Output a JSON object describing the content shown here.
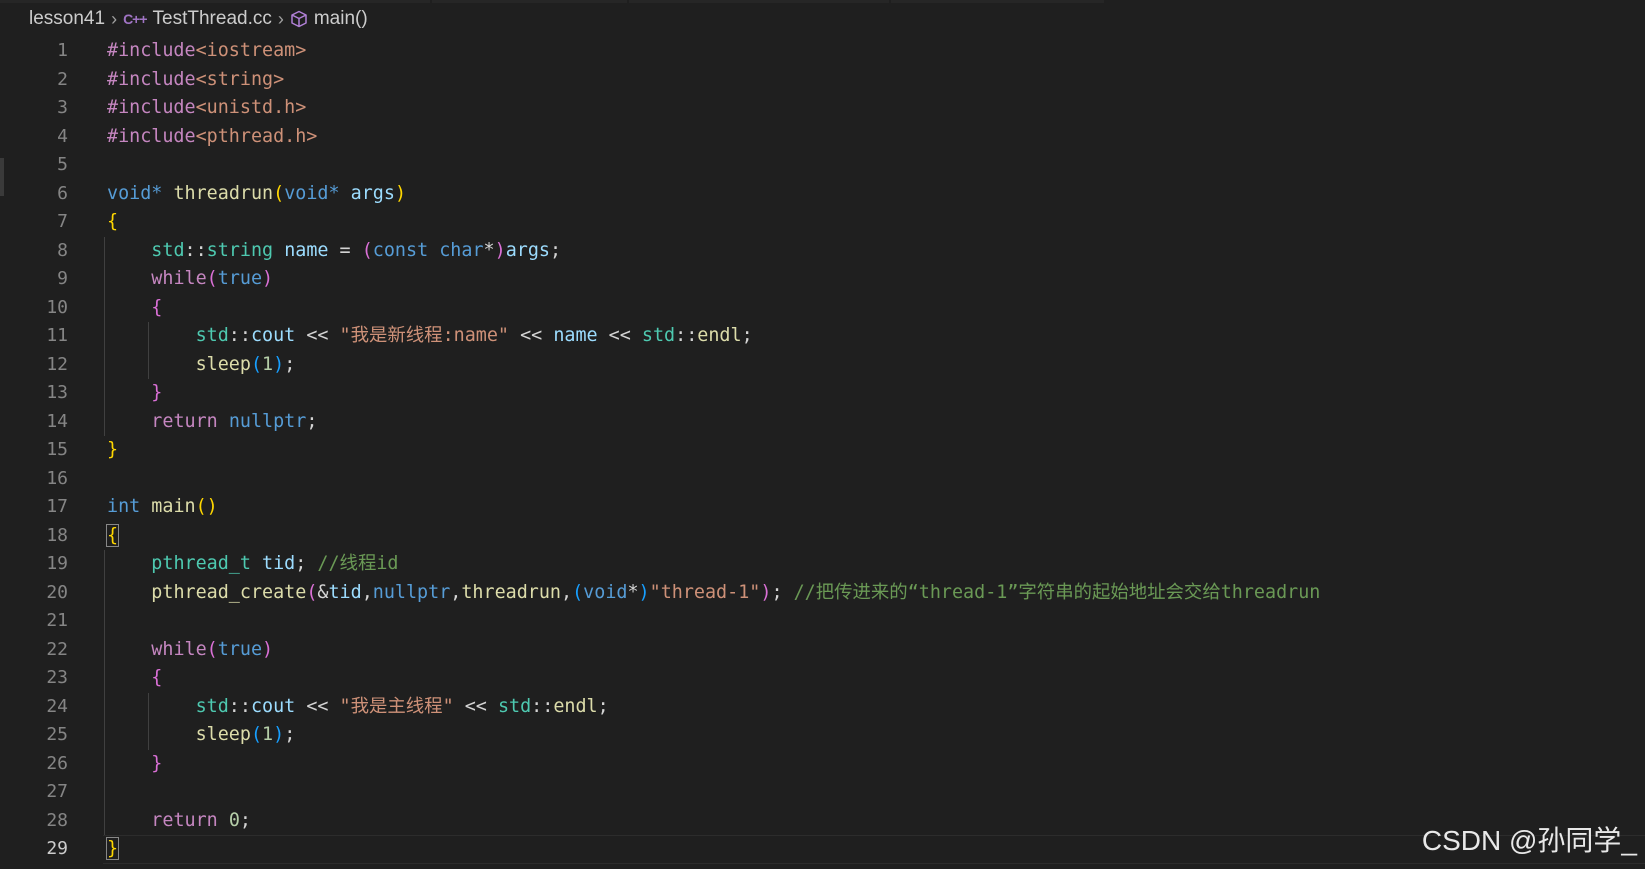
{
  "breadcrumb": {
    "folder": "lesson41",
    "file_icon": "C++",
    "file": "TestThread.cc",
    "symbol_icon": "cube-icon",
    "symbol": "main()"
  },
  "editor": {
    "current_line": 29,
    "lines": [
      {
        "n": "1",
        "tokens": [
          [
            "pp",
            "#include"
          ],
          [
            "str",
            "<iostream>"
          ]
        ]
      },
      {
        "n": "2",
        "tokens": [
          [
            "pp",
            "#include"
          ],
          [
            "str",
            "<string>"
          ]
        ]
      },
      {
        "n": "3",
        "tokens": [
          [
            "pp",
            "#include"
          ],
          [
            "str",
            "<unistd.h>"
          ]
        ]
      },
      {
        "n": "4",
        "tokens": [
          [
            "pp",
            "#include"
          ],
          [
            "str",
            "<pthread.h>"
          ]
        ]
      },
      {
        "n": "5",
        "tokens": []
      },
      {
        "n": "6",
        "tokens": [
          [
            "kw",
            "void"
          ],
          [
            "kw",
            "*"
          ],
          [
            "pl",
            " "
          ],
          [
            "fn",
            "threadrun"
          ],
          [
            "b1",
            "("
          ],
          [
            "kw",
            "void"
          ],
          [
            "kw",
            "*"
          ],
          [
            "pl",
            " "
          ],
          [
            "var",
            "args"
          ],
          [
            "b1",
            ")"
          ]
        ]
      },
      {
        "n": "7",
        "tokens": [
          [
            "b1",
            "{"
          ]
        ]
      },
      {
        "n": "8",
        "tokens": [
          [
            "pl",
            "    "
          ],
          [
            "type",
            "std"
          ],
          [
            "pl",
            "::"
          ],
          [
            "type",
            "string"
          ],
          [
            "pl",
            " "
          ],
          [
            "var",
            "name"
          ],
          [
            "pl",
            " = "
          ],
          [
            "b2",
            "("
          ],
          [
            "kw",
            "const"
          ],
          [
            "pl",
            " "
          ],
          [
            "kw",
            "char"
          ],
          [
            "pl",
            "*"
          ],
          [
            "b2",
            ")"
          ],
          [
            "var",
            "args"
          ],
          [
            "pl",
            ";"
          ]
        ]
      },
      {
        "n": "9",
        "tokens": [
          [
            "pl",
            "    "
          ],
          [
            "ctl",
            "while"
          ],
          [
            "b2",
            "("
          ],
          [
            "kw",
            "true"
          ],
          [
            "b2",
            ")"
          ]
        ]
      },
      {
        "n": "10",
        "tokens": [
          [
            "pl",
            "    "
          ],
          [
            "b2",
            "{"
          ]
        ]
      },
      {
        "n": "11",
        "tokens": [
          [
            "pl",
            "        "
          ],
          [
            "type",
            "std"
          ],
          [
            "pl",
            "::"
          ],
          [
            "var",
            "cout"
          ],
          [
            "pl",
            " << "
          ],
          [
            "str",
            "\"我是新线程:name\""
          ],
          [
            "pl",
            " << "
          ],
          [
            "var",
            "name"
          ],
          [
            "pl",
            " << "
          ],
          [
            "type",
            "std"
          ],
          [
            "pl",
            "::"
          ],
          [
            "fn",
            "endl"
          ],
          [
            "pl",
            ";"
          ]
        ]
      },
      {
        "n": "12",
        "tokens": [
          [
            "pl",
            "        "
          ],
          [
            "fn",
            "sleep"
          ],
          [
            "b3",
            "("
          ],
          [
            "num",
            "1"
          ],
          [
            "b3",
            ")"
          ],
          [
            "pl",
            ";"
          ]
        ]
      },
      {
        "n": "13",
        "tokens": [
          [
            "pl",
            "    "
          ],
          [
            "b2",
            "}"
          ]
        ]
      },
      {
        "n": "14",
        "tokens": [
          [
            "pl",
            "    "
          ],
          [
            "ctl",
            "return"
          ],
          [
            "pl",
            " "
          ],
          [
            "kw",
            "nullptr"
          ],
          [
            "pl",
            ";"
          ]
        ]
      },
      {
        "n": "15",
        "tokens": [
          [
            "b1",
            "}"
          ]
        ]
      },
      {
        "n": "16",
        "tokens": []
      },
      {
        "n": "17",
        "tokens": [
          [
            "kw",
            "int"
          ],
          [
            "pl",
            " "
          ],
          [
            "fn",
            "main"
          ],
          [
            "b1",
            "()"
          ]
        ]
      },
      {
        "n": "18",
        "tokens": [
          [
            "b1",
            "{"
          ]
        ]
      },
      {
        "n": "19",
        "tokens": [
          [
            "pl",
            "    "
          ],
          [
            "type",
            "pthread_t"
          ],
          [
            "pl",
            " "
          ],
          [
            "var",
            "tid"
          ],
          [
            "pl",
            "; "
          ],
          [
            "com",
            "//线程id"
          ]
        ]
      },
      {
        "n": "20",
        "tokens": [
          [
            "pl",
            "    "
          ],
          [
            "fn",
            "pthread_create"
          ],
          [
            "b2",
            "("
          ],
          [
            "pl",
            "&"
          ],
          [
            "var",
            "tid"
          ],
          [
            "pl",
            ","
          ],
          [
            "kw",
            "nullptr"
          ],
          [
            "pl",
            ","
          ],
          [
            "fn",
            "threadrun"
          ],
          [
            "pl",
            ","
          ],
          [
            "b3",
            "("
          ],
          [
            "kw",
            "void"
          ],
          [
            "pl",
            "*"
          ],
          [
            "b3",
            ")"
          ],
          [
            "str",
            "\"thread-1\""
          ],
          [
            "b2",
            ")"
          ],
          [
            "pl",
            "; "
          ],
          [
            "com",
            "//把传进来的“thread-1”字符串的起始地址会交给threadrun"
          ]
        ]
      },
      {
        "n": "21",
        "tokens": []
      },
      {
        "n": "22",
        "tokens": [
          [
            "pl",
            "    "
          ],
          [
            "ctl",
            "while"
          ],
          [
            "b2",
            "("
          ],
          [
            "kw",
            "true"
          ],
          [
            "b2",
            ")"
          ]
        ]
      },
      {
        "n": "23",
        "tokens": [
          [
            "pl",
            "    "
          ],
          [
            "b2",
            "{"
          ]
        ]
      },
      {
        "n": "24",
        "tokens": [
          [
            "pl",
            "        "
          ],
          [
            "type",
            "std"
          ],
          [
            "pl",
            "::"
          ],
          [
            "var",
            "cout"
          ],
          [
            "pl",
            " << "
          ],
          [
            "str",
            "\"我是主线程\""
          ],
          [
            "pl",
            " << "
          ],
          [
            "type",
            "std"
          ],
          [
            "pl",
            "::"
          ],
          [
            "fn",
            "endl"
          ],
          [
            "pl",
            ";"
          ]
        ]
      },
      {
        "n": "25",
        "tokens": [
          [
            "pl",
            "        "
          ],
          [
            "fn",
            "sleep"
          ],
          [
            "b3",
            "("
          ],
          [
            "num",
            "1"
          ],
          [
            "b3",
            ")"
          ],
          [
            "pl",
            ";"
          ]
        ]
      },
      {
        "n": "26",
        "tokens": [
          [
            "pl",
            "    "
          ],
          [
            "b2",
            "}"
          ]
        ]
      },
      {
        "n": "27",
        "tokens": []
      },
      {
        "n": "28",
        "tokens": [
          [
            "pl",
            "    "
          ],
          [
            "ctl",
            "return"
          ],
          [
            "pl",
            " "
          ],
          [
            "num",
            "0"
          ],
          [
            "pl",
            ";"
          ]
        ]
      },
      {
        "n": "29",
        "tokens": [
          [
            "b1",
            "}"
          ]
        ]
      }
    ]
  },
  "watermark": "CSDN @孙同学_"
}
